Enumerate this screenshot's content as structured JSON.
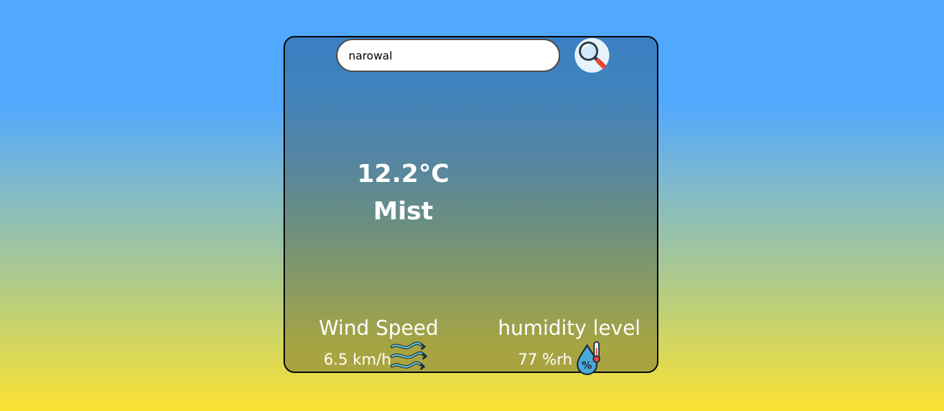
{
  "search": {
    "value": "narowal"
  },
  "weather": {
    "temperature": "12.2°C",
    "condition": "Mist"
  },
  "wind": {
    "label": "Wind Speed",
    "value": "6.5 km/h"
  },
  "humidity": {
    "label": "humidity level",
    "value": "77 %rh"
  },
  "icons": {
    "search": "magnifier-icon",
    "wind": "wind-icon",
    "humidity": "humidity-drop-icon"
  },
  "colors": {
    "background_top": "#51a8ff",
    "background_bottom": "#fbe232",
    "card_top": "#3a80c2",
    "card_bottom": "#aba43f",
    "text": "#ffffff"
  }
}
